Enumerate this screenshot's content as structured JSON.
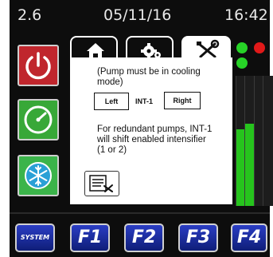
{
  "status_bar": {
    "value": "2.6",
    "date": "05/11/16",
    "time": "16:42"
  },
  "side_buttons": [
    {
      "name": "power",
      "color": "#c0262d"
    },
    {
      "name": "gauge",
      "color": "#38a838"
    },
    {
      "name": "cooling",
      "color": "#3bb44a"
    }
  ],
  "tabs": [
    {
      "name": "home-tab",
      "icon": "home-icon",
      "active": false
    },
    {
      "name": "gear-tab",
      "icon": "gear-icon",
      "active": false
    },
    {
      "name": "tools-tab",
      "icon": "tools-icon",
      "active": true
    }
  ],
  "panel": {
    "note": "(Pump must be in cooling mode)",
    "left_label": "Left",
    "int_label": "INT-1",
    "right_label": "Right",
    "description": "For redundant pumps, INT-1 will shift enabled intensifier (1 or 2)",
    "settings_icon": "list-settings-icon"
  },
  "indicators": {
    "led_left_color": "#27d327",
    "led_right_color": "#e01919",
    "led_bottom_color": "#27d327",
    "meters": [
      {
        "name": "meter-1",
        "level": 0.59
      },
      {
        "name": "meter-2",
        "level": 0.63
      },
      {
        "name": "meter-3",
        "level": 0
      },
      {
        "name": "meter-4",
        "level": 0
      }
    ]
  },
  "function_keys": [
    {
      "label": "SYSTEM"
    },
    {
      "label": "F1"
    },
    {
      "label": "F2"
    },
    {
      "label": "F3"
    },
    {
      "label": "F4"
    }
  ]
}
